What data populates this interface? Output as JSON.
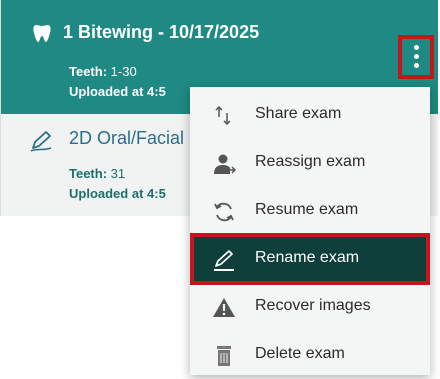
{
  "exams": [
    {
      "title": "1 Bitewing - 10/17/2025",
      "teeth_label": "Teeth:",
      "teeth_value": "1-30",
      "uploaded_label": "Uploaded at",
      "uploaded_value": "4:5",
      "icon": "tooth-icon"
    },
    {
      "title": "2D Oral/Facial",
      "teeth_label": "Teeth:",
      "teeth_value": "31",
      "uploaded_label": "Uploaded at",
      "uploaded_value": "4:5",
      "icon": "pen-icon"
    }
  ],
  "menu": {
    "items": [
      {
        "label": "Share exam",
        "icon": "share-icon"
      },
      {
        "label": "Reassign exam",
        "icon": "reassign-icon"
      },
      {
        "label": "Resume exam",
        "icon": "resume-icon"
      },
      {
        "label": "Rename exam",
        "icon": "rename-icon",
        "selected": true
      },
      {
        "label": "Recover images",
        "icon": "warning-icon"
      },
      {
        "label": "Delete exam",
        "icon": "trash-icon"
      }
    ]
  },
  "colors": {
    "active_card": "#1f8a83",
    "selected_item": "#0e3f3b",
    "highlight_outline": "#c4161c"
  }
}
